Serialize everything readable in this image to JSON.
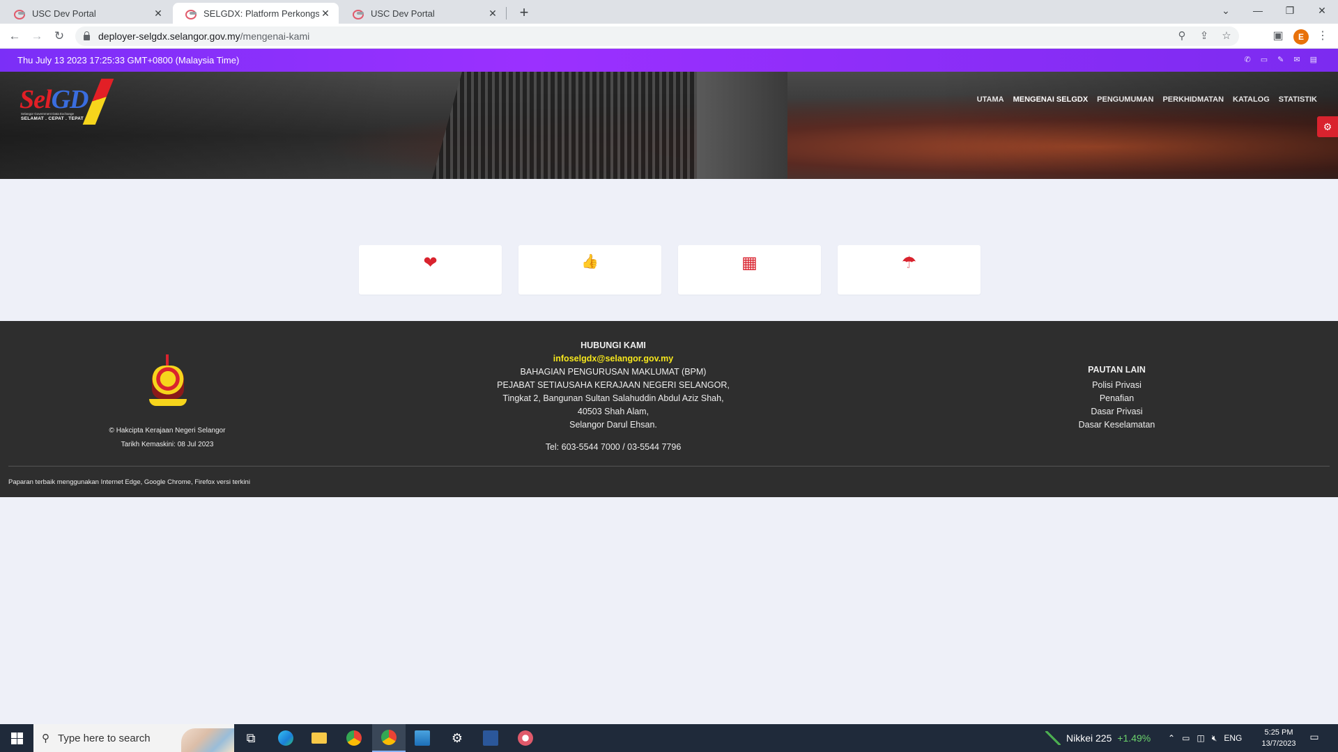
{
  "browser": {
    "tabs": [
      {
        "title": "USC Dev Portal"
      },
      {
        "title": "SELGDX: Platform Perkongsian D..."
      },
      {
        "title": "USC Dev Portal"
      }
    ],
    "url_host": "deployer-selgdx.selangor.gov.my",
    "url_path": "/mengenai-kami",
    "profile_initial": "E"
  },
  "site": {
    "datetime": "Thu July 13 2023 17:25:33 GMT+0800 (Malaysia Time)",
    "logo": {
      "tagline": "SELAMAT . CEPAT . TEPAT",
      "subtitle": "Selangor Government Data Exchange"
    },
    "nav": [
      {
        "label": "UTAMA"
      },
      {
        "label": "MENGENAI SELGDX"
      },
      {
        "label": "PENGUMUMAN"
      },
      {
        "label": "PERKHIDMATAN"
      },
      {
        "label": "KATALOG"
      },
      {
        "label": "STATISTIK"
      }
    ],
    "cards": [
      {
        "icon": "heart-icon",
        "glyph": "❤"
      },
      {
        "icon": "thumbs-up-icon",
        "glyph": "👍"
      },
      {
        "icon": "building-icon",
        "glyph": "▦"
      },
      {
        "icon": "umbrella-icon",
        "glyph": "☂"
      }
    ]
  },
  "footer": {
    "copyright": "© Hakcipta Kerajaan Negeri Selangor",
    "updated": "Tarikh Kemaskini: 08 Jul 2023",
    "contact_heading": "HUBUNGI KAMI",
    "email": "infoselgdx@selangor.gov.my",
    "address": [
      "BAHAGIAN PENGURUSAN MAKLUMAT (BPM)",
      "PEJABAT SETIAUSAHA KERAJAAN NEGERI SELANGOR,",
      "Tingkat 2, Bangunan Sultan Salahuddin Abdul Aziz Shah,",
      "40503 Shah Alam,",
      "Selangor Darul Ehsan."
    ],
    "tel": "Tel: 603-5544 7000 / 03-5544 7796",
    "links_heading": "PAUTAN LAIN",
    "links": [
      "Polisi Privasi",
      "Penafian",
      "Dasar Privasi",
      "Dasar Keselamatan"
    ],
    "footnote": "Paparan terbaik menggunakan Internet Edge, Google Chrome, Firefox versi terkini",
    "crest_label": "SELANGOR"
  },
  "taskbar": {
    "search_placeholder": "Type here to search",
    "nikkei_label": "Nikkei 225",
    "nikkei_change": "+1.49%",
    "lang": "ENG",
    "time": "5:25 PM",
    "date": "13/7/2023"
  },
  "colors": {
    "accent_purple": "#8a2be2",
    "brand_red": "#d9232e",
    "email_yellow": "#f6e71c",
    "footer_bg": "#2e2e2e"
  }
}
